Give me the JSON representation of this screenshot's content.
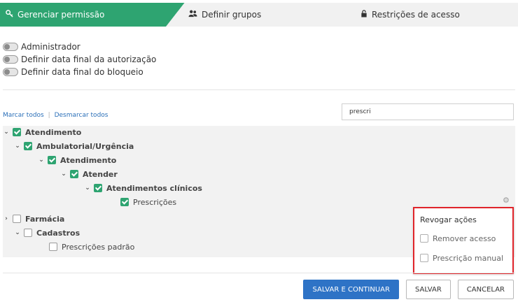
{
  "tabs": [
    {
      "label": "Gerenciar permissão",
      "icon": "key-icon",
      "active": true
    },
    {
      "label": "Definir grupos",
      "icon": "users-icon",
      "active": false
    },
    {
      "label": "Restrições de acesso",
      "icon": "lock-icon",
      "active": false
    }
  ],
  "toggles": [
    {
      "label": "Administrador",
      "on": false
    },
    {
      "label": "Definir data final da autorização",
      "on": false
    },
    {
      "label": "Definir data final do bloqueio",
      "on": false
    }
  ],
  "links": {
    "select_all": "Marcar todos",
    "deselect_all": "Desmarcar todos"
  },
  "search": {
    "value": "prescri"
  },
  "tree": [
    {
      "label": "Atendimento",
      "expanded": true,
      "checked": true,
      "bold": true
    },
    {
      "label": "Ambulatorial/Urgência",
      "expanded": true,
      "checked": true,
      "bold": true
    },
    {
      "label": "Atendimento",
      "expanded": true,
      "checked": true,
      "bold": true
    },
    {
      "label": "Atender",
      "expanded": true,
      "checked": true,
      "bold": true
    },
    {
      "label": "Atendimentos clínicos",
      "expanded": true,
      "checked": true,
      "bold": true
    },
    {
      "label": "Prescrições",
      "checked": true,
      "bold": false
    },
    {
      "label": "Farmácia",
      "expanded": false,
      "checked": false,
      "bold": true
    },
    {
      "label": "Cadastros",
      "expanded": true,
      "checked": false,
      "bold": true
    },
    {
      "label": "Prescrições padrão",
      "checked": false,
      "bold": false
    }
  ],
  "popup": {
    "title": "Revogar ações",
    "options": [
      {
        "label": "Remover acesso",
        "checked": false
      },
      {
        "label": "Prescrição manual",
        "checked": false
      }
    ]
  },
  "buttons": {
    "save_continue": "SALVAR E CONTINUAR",
    "save": "SALVAR",
    "cancel": "CANCELAR"
  },
  "colors": {
    "accent": "#2ea471",
    "primary": "#2e73c6",
    "highlight": "#e0242a"
  }
}
